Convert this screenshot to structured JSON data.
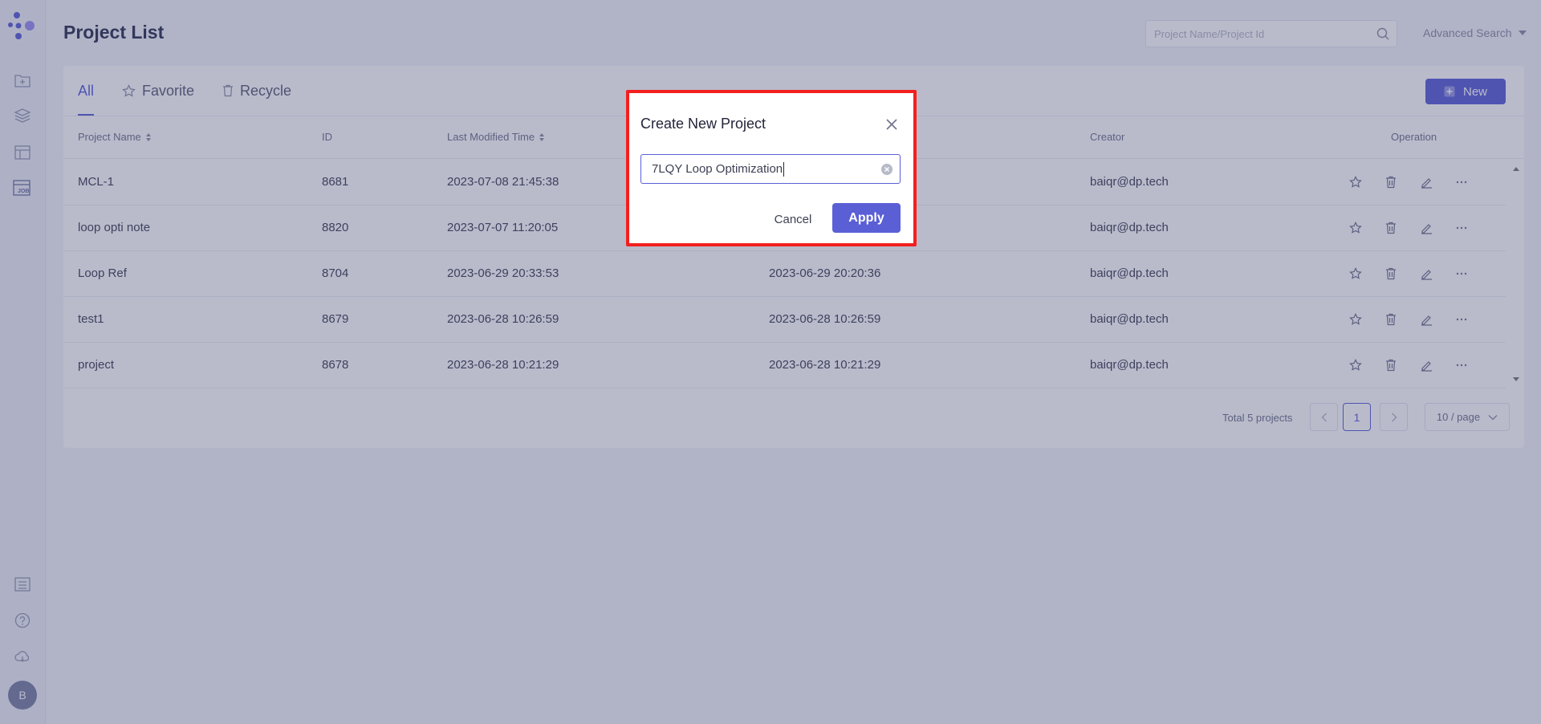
{
  "header": {
    "title": "Project List",
    "search_placeholder": "Project Name/Project Id",
    "advanced_search": "Advanced Search"
  },
  "sidebar": {
    "items": [
      "folder-add-icon",
      "layers-icon",
      "table-icon",
      "job-icon"
    ],
    "bottom_items": [
      "list-icon",
      "help-icon",
      "cloud-icon"
    ],
    "avatar_letter": "B",
    "job_label": "JOB"
  },
  "tabs": [
    {
      "label": "All",
      "active": true
    },
    {
      "label": "Favorite",
      "active": false
    },
    {
      "label": "Recycle",
      "active": false
    }
  ],
  "toolbar": {
    "new_label": "New"
  },
  "table": {
    "columns": [
      "Project Name",
      "ID",
      "Last Modified Time",
      "Creator",
      "Operation"
    ],
    "rows": [
      {
        "name": "MCL-1",
        "id": "8681",
        "modified": "2023-07-08 21:45:38",
        "created": "",
        "creator": "baiqr@dp.tech"
      },
      {
        "name": "loop opti note",
        "id": "8820",
        "modified": "2023-07-07 11:20:05",
        "created": "",
        "creator": "baiqr@dp.tech"
      },
      {
        "name": "Loop Ref",
        "id": "8704",
        "modified": "2023-06-29 20:33:53",
        "created": "2023-06-29 20:20:36",
        "creator": "baiqr@dp.tech"
      },
      {
        "name": "test1",
        "id": "8679",
        "modified": "2023-06-28 10:26:59",
        "created": "2023-06-28 10:26:59",
        "creator": "baiqr@dp.tech"
      },
      {
        "name": "project",
        "id": "8678",
        "modified": "2023-06-28 10:21:29",
        "created": "2023-06-28 10:21:29",
        "creator": "baiqr@dp.tech"
      }
    ]
  },
  "pagination": {
    "total": "Total 5 projects",
    "current_page": "1",
    "page_size": "10 / page"
  },
  "modal": {
    "title": "Create New Project",
    "input_value": "7LQY Loop Optimization",
    "cancel_label": "Cancel",
    "apply_label": "Apply",
    "highlight_color": "#f2201e"
  },
  "colors": {
    "accent": "#5a5fd6",
    "overlay": "#3c426e"
  }
}
